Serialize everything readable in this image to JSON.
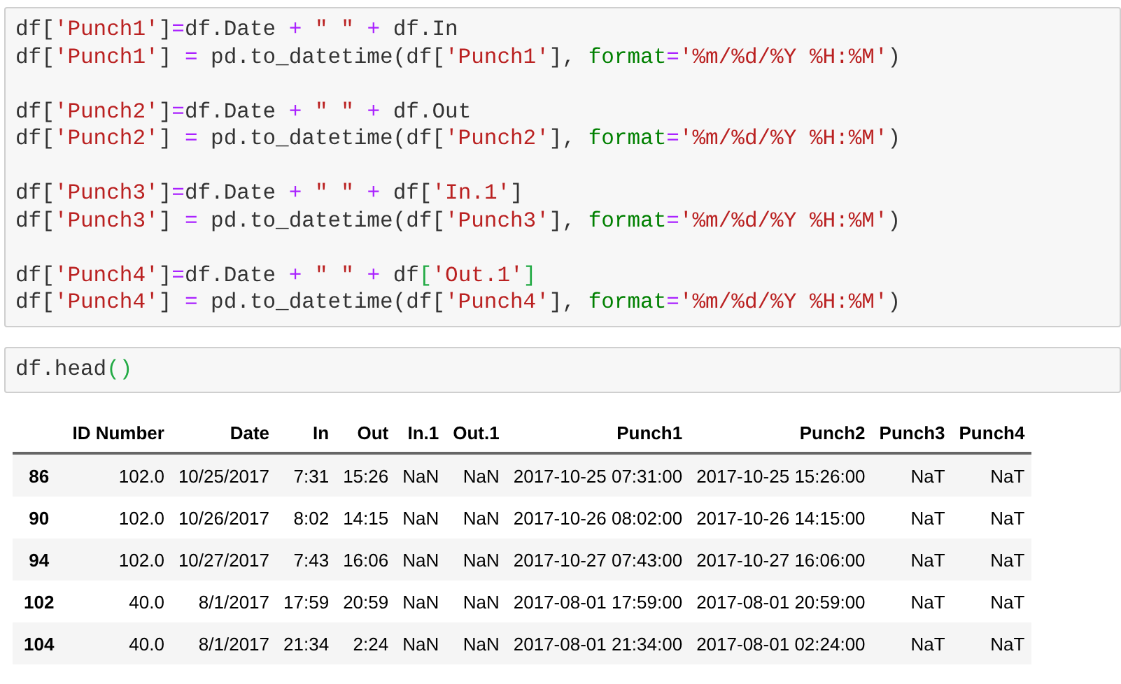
{
  "code_cells": [
    {
      "blocks": [
        [
          [
            {
              "kind": "plain",
              "text": "df["
            },
            {
              "kind": "string",
              "text": "'Punch1'"
            },
            {
              "kind": "plain",
              "text": "]"
            },
            {
              "kind": "operator",
              "text": "="
            },
            {
              "kind": "plain",
              "text": "df.Date "
            },
            {
              "kind": "operator",
              "text": "+"
            },
            {
              "kind": "string",
              "text": " \" \" "
            },
            {
              "kind": "operator",
              "text": "+"
            },
            {
              "kind": "plain",
              "text": " df.In"
            }
          ],
          [
            {
              "kind": "plain",
              "text": "df["
            },
            {
              "kind": "string",
              "text": "'Punch1'"
            },
            {
              "kind": "plain",
              "text": "] "
            },
            {
              "kind": "operator",
              "text": "="
            },
            {
              "kind": "plain",
              "text": " pd.to_datetime(df["
            },
            {
              "kind": "string",
              "text": "'Punch1'"
            },
            {
              "kind": "plain",
              "text": "], "
            },
            {
              "kind": "keyword",
              "text": "format"
            },
            {
              "kind": "operator",
              "text": "="
            },
            {
              "kind": "string",
              "text": "'%m/%d/%Y %H:%M'"
            },
            {
              "kind": "plain",
              "text": ")"
            }
          ]
        ],
        [
          [
            {
              "kind": "plain",
              "text": "df["
            },
            {
              "kind": "string",
              "text": "'Punch2'"
            },
            {
              "kind": "plain",
              "text": "]"
            },
            {
              "kind": "operator",
              "text": "="
            },
            {
              "kind": "plain",
              "text": "df.Date "
            },
            {
              "kind": "operator",
              "text": "+"
            },
            {
              "kind": "string",
              "text": " \" \" "
            },
            {
              "kind": "operator",
              "text": "+"
            },
            {
              "kind": "plain",
              "text": " df.Out"
            }
          ],
          [
            {
              "kind": "plain",
              "text": "df["
            },
            {
              "kind": "string",
              "text": "'Punch2'"
            },
            {
              "kind": "plain",
              "text": "] "
            },
            {
              "kind": "operator",
              "text": "="
            },
            {
              "kind": "plain",
              "text": " pd.to_datetime(df["
            },
            {
              "kind": "string",
              "text": "'Punch2'"
            },
            {
              "kind": "plain",
              "text": "], "
            },
            {
              "kind": "keyword",
              "text": "format"
            },
            {
              "kind": "operator",
              "text": "="
            },
            {
              "kind": "string",
              "text": "'%m/%d/%Y %H:%M'"
            },
            {
              "kind": "plain",
              "text": ")"
            }
          ]
        ],
        [
          [
            {
              "kind": "plain",
              "text": "df["
            },
            {
              "kind": "string",
              "text": "'Punch3'"
            },
            {
              "kind": "plain",
              "text": "]"
            },
            {
              "kind": "operator",
              "text": "="
            },
            {
              "kind": "plain",
              "text": "df.Date "
            },
            {
              "kind": "operator",
              "text": "+"
            },
            {
              "kind": "string",
              "text": " \" \" "
            },
            {
              "kind": "operator",
              "text": "+"
            },
            {
              "kind": "plain",
              "text": " df["
            },
            {
              "kind": "string",
              "text": "'In.1'"
            },
            {
              "kind": "plain",
              "text": "]"
            }
          ],
          [
            {
              "kind": "plain",
              "text": "df["
            },
            {
              "kind": "string",
              "text": "'Punch3'"
            },
            {
              "kind": "plain",
              "text": "] "
            },
            {
              "kind": "operator",
              "text": "="
            },
            {
              "kind": "plain",
              "text": " pd.to_datetime(df["
            },
            {
              "kind": "string",
              "text": "'Punch3'"
            },
            {
              "kind": "plain",
              "text": "], "
            },
            {
              "kind": "keyword",
              "text": "format"
            },
            {
              "kind": "operator",
              "text": "="
            },
            {
              "kind": "string",
              "text": "'%m/%d/%Y %H:%M'"
            },
            {
              "kind": "plain",
              "text": ")"
            }
          ]
        ],
        [
          [
            {
              "kind": "plain",
              "text": "df["
            },
            {
              "kind": "string",
              "text": "'Punch4'"
            },
            {
              "kind": "plain",
              "text": "]"
            },
            {
              "kind": "operator",
              "text": "="
            },
            {
              "kind": "plain",
              "text": "df.Date "
            },
            {
              "kind": "operator",
              "text": "+"
            },
            {
              "kind": "string",
              "text": " \" \" "
            },
            {
              "kind": "operator",
              "text": "+"
            },
            {
              "kind": "plain",
              "text": " df"
            },
            {
              "kind": "match",
              "text": "["
            },
            {
              "kind": "string",
              "text": "'Out.1'"
            },
            {
              "kind": "match",
              "text": "]"
            }
          ],
          [
            {
              "kind": "plain",
              "text": "df["
            },
            {
              "kind": "string",
              "text": "'Punch4'"
            },
            {
              "kind": "plain",
              "text": "] "
            },
            {
              "kind": "operator",
              "text": "="
            },
            {
              "kind": "plain",
              "text": " pd.to_datetime(df["
            },
            {
              "kind": "string",
              "text": "'Punch4'"
            },
            {
              "kind": "plain",
              "text": "], "
            },
            {
              "kind": "keyword",
              "text": "format"
            },
            {
              "kind": "operator",
              "text": "="
            },
            {
              "kind": "string",
              "text": "'%m/%d/%Y %H:%M'"
            },
            {
              "kind": "plain",
              "text": ")"
            }
          ]
        ]
      ]
    },
    {
      "blocks": [
        [
          [
            {
              "kind": "plain",
              "text": "df.head"
            },
            {
              "kind": "match",
              "text": "()"
            }
          ]
        ]
      ]
    }
  ],
  "table": {
    "columns": [
      "ID Number",
      "Date",
      "In",
      "Out",
      "In.1",
      "Out.1",
      "Punch1",
      "Punch2",
      "Punch3",
      "Punch4"
    ],
    "rows": [
      {
        "index": "86",
        "cells": [
          "102.0",
          "10/25/2017",
          "7:31",
          "15:26",
          "NaN",
          "NaN",
          "2017-10-25 07:31:00",
          "2017-10-25 15:26:00",
          "NaT",
          "NaT"
        ]
      },
      {
        "index": "90",
        "cells": [
          "102.0",
          "10/26/2017",
          "8:02",
          "14:15",
          "NaN",
          "NaN",
          "2017-10-26 08:02:00",
          "2017-10-26 14:15:00",
          "NaT",
          "NaT"
        ]
      },
      {
        "index": "94",
        "cells": [
          "102.0",
          "10/27/2017",
          "7:43",
          "16:06",
          "NaN",
          "NaN",
          "2017-10-27 07:43:00",
          "2017-10-27 16:06:00",
          "NaT",
          "NaT"
        ]
      },
      {
        "index": "102",
        "cells": [
          "40.0",
          "8/1/2017",
          "17:59",
          "20:59",
          "NaN",
          "NaN",
          "2017-08-01 17:59:00",
          "2017-08-01 20:59:00",
          "NaT",
          "NaT"
        ]
      },
      {
        "index": "104",
        "cells": [
          "40.0",
          "8/1/2017",
          "21:34",
          "2:24",
          "NaN",
          "NaN",
          "2017-08-01 21:34:00",
          "2017-08-01 02:24:00",
          "NaT",
          "NaT"
        ]
      }
    ]
  }
}
